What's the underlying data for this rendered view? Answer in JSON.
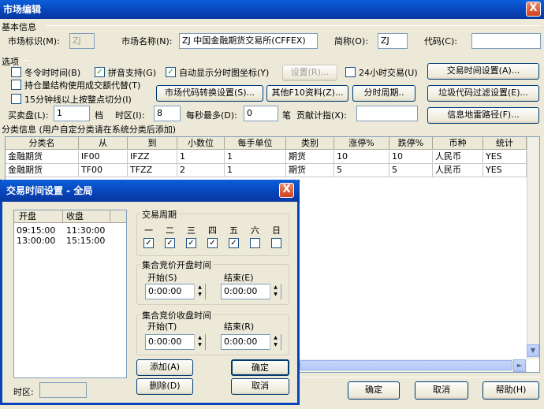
{
  "window": {
    "title": "市场编辑",
    "close": "X"
  },
  "basic": {
    "section": "基本信息",
    "market_id_label": "市场标识(M):",
    "market_id_value": "ZJ",
    "market_name_label": "市场名称(N):",
    "market_name_value": "ZJ 中国金融期货交易所(CFFEX)",
    "abbr_label": "简称(O):",
    "abbr_value": "ZJ",
    "code_label": "代码(C):",
    "code_value": ""
  },
  "options": {
    "section": "选项",
    "winter_time": "冬令时时间(B)",
    "pinyin": "拼音支持(G)",
    "auto_axis": "自动显示分时图坐标(Y)",
    "settings_btn": "设置(R)...",
    "h24": "24小时交易(U)",
    "trade_time_btn": "交易时间设置(A)...",
    "hold_struct": "持仓量结构使用成交额代替(T)",
    "code_convert_btn": "市场代码转换设置(S)...",
    "f10_btn": "其他F10资料(Z)...",
    "period_btn": "分时周期..",
    "garbage_btn": "垃圾代码过滤设置(E)...",
    "min15": "15分钟线以上按整点切分(I)",
    "buy_sell_label": "买卖盘(L):",
    "buy_sell_value": "1",
    "level_label": "档",
    "tz_label": "时区(I):",
    "tz_value": "8",
    "per_sec_label": "每秒最多(D):",
    "per_sec_value": "0",
    "per_sec_unit": "笔",
    "contrib_label": "贡献计指(X):",
    "contrib_value": "",
    "info_path_btn": "信息地雷路径(F)..."
  },
  "category": {
    "section": "分类信息 (用户自定分类请在系统分类后添加)",
    "columns": [
      "分类名",
      "从",
      "到",
      "小数位",
      "每手单位",
      "类别",
      "涨停%",
      "跌停%",
      "币种",
      "统计"
    ],
    "rows": [
      [
        "金融期货",
        "IF00",
        "IFZZ",
        "1",
        "1",
        "期货",
        "10",
        "10",
        "人民币",
        "YES"
      ],
      [
        "金融期货",
        "TF00",
        "TFZZ",
        "2",
        "1",
        "期货",
        "5",
        "5",
        "人民币",
        "YES"
      ]
    ]
  },
  "footer": {
    "ok": "确定",
    "cancel": "取消",
    "help": "帮助(H)"
  },
  "dialog": {
    "title": "交易时间设置 - 全局",
    "close": "X",
    "list_headers": [
      "开盘",
      "收盘"
    ],
    "list_rows": [
      [
        "09:15:00",
        "11:30:00"
      ],
      [
        "13:00:00",
        "15:15:00"
      ]
    ],
    "tz_label": "时区:",
    "week_group": "交易周期",
    "days": [
      "一",
      "二",
      "三",
      "四",
      "五",
      "六",
      "日"
    ],
    "days_checked": [
      true,
      true,
      true,
      true,
      true,
      false,
      false
    ],
    "open_auction": "集合竞价开盘时间",
    "close_auction": "集合竞价收盘时间",
    "start_s": "开始(S)",
    "end_e": "结束(E)",
    "start_t": "开始(T)",
    "end_r": "结束(R)",
    "time_values": [
      "0:00:00",
      "0:00:00",
      "0:00:00",
      "0:00:00"
    ],
    "add_btn": "添加(A)",
    "ok_btn": "确定",
    "del_btn": "删除(D)",
    "cancel_btn": "取消"
  }
}
